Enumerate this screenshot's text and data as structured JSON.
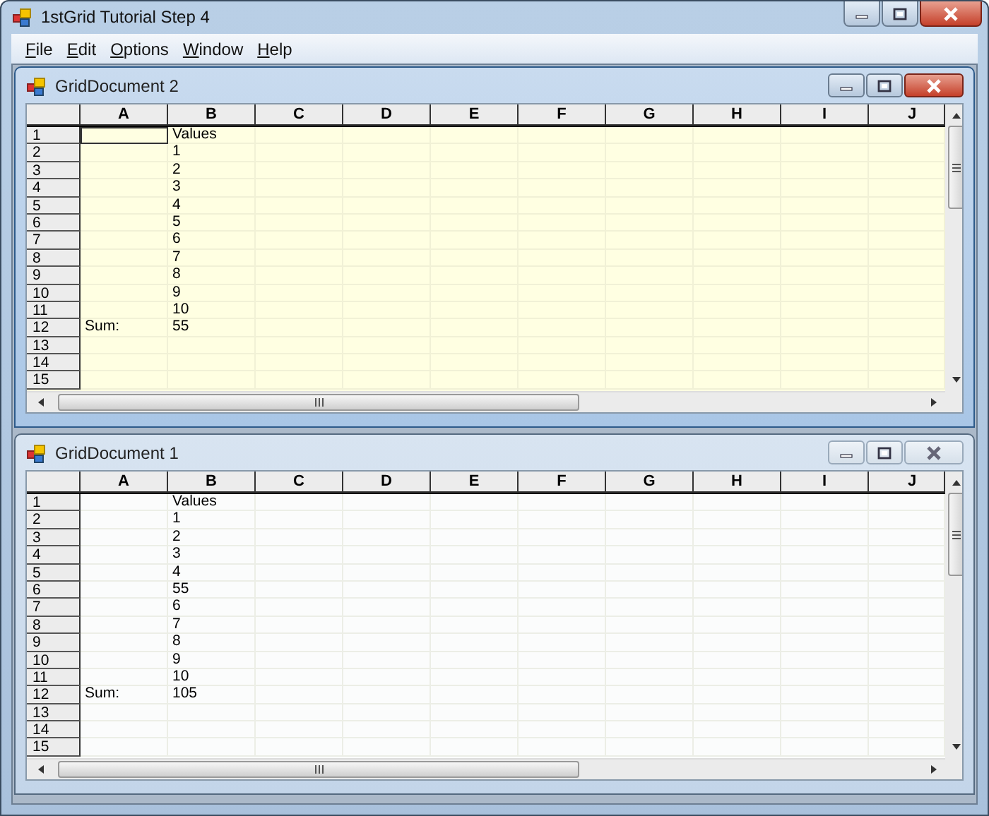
{
  "window": {
    "title": "1stGrid Tutorial Step 4"
  },
  "menu": [
    {
      "label": "File"
    },
    {
      "label": "Edit"
    },
    {
      "label": "Options"
    },
    {
      "label": "Window"
    },
    {
      "label": "Help"
    }
  ],
  "documents": [
    {
      "title": "GridDocument 2",
      "active": true,
      "columns": [
        "A",
        "B",
        "C",
        "D",
        "E",
        "F",
        "G",
        "H",
        "I",
        "J"
      ],
      "rows": [
        {
          "header": "1",
          "cells": [
            {
              "text": "",
              "selected": true
            },
            {
              "text": "Values",
              "selected": false
            }
          ]
        },
        {
          "header": "2",
          "cells": [
            {
              "text": "",
              "selected": false
            },
            {
              "text": "1",
              "selected": false
            }
          ]
        },
        {
          "header": "3",
          "cells": [
            {
              "text": "",
              "selected": false
            },
            {
              "text": "2",
              "selected": false
            }
          ]
        },
        {
          "header": "4",
          "cells": [
            {
              "text": "",
              "selected": false
            },
            {
              "text": "3",
              "selected": false
            }
          ]
        },
        {
          "header": "5",
          "cells": [
            {
              "text": "",
              "selected": false
            },
            {
              "text": "4",
              "selected": false
            }
          ]
        },
        {
          "header": "6",
          "cells": [
            {
              "text": "",
              "selected": false
            },
            {
              "text": "5",
              "selected": false
            }
          ]
        },
        {
          "header": "7",
          "cells": [
            {
              "text": "",
              "selected": false
            },
            {
              "text": "6",
              "selected": false
            }
          ]
        },
        {
          "header": "8",
          "cells": [
            {
              "text": "",
              "selected": false
            },
            {
              "text": "7",
              "selected": false
            }
          ]
        },
        {
          "header": "9",
          "cells": [
            {
              "text": "",
              "selected": false
            },
            {
              "text": "8",
              "selected": false
            }
          ]
        },
        {
          "header": "10",
          "cells": [
            {
              "text": "",
              "selected": false
            },
            {
              "text": "9",
              "selected": false
            }
          ]
        },
        {
          "header": "11",
          "cells": [
            {
              "text": "",
              "selected": false
            },
            {
              "text": "10",
              "selected": false
            }
          ]
        },
        {
          "header": "12",
          "cells": [
            {
              "text": "Sum:",
              "selected": false
            },
            {
              "text": "55",
              "selected": false
            }
          ]
        },
        {
          "header": "13",
          "cells": []
        },
        {
          "header": "14",
          "cells": []
        },
        {
          "header": "15",
          "cells": []
        }
      ]
    },
    {
      "title": "GridDocument 1",
      "active": false,
      "columns": [
        "A",
        "B",
        "C",
        "D",
        "E",
        "F",
        "G",
        "H",
        "I",
        "J"
      ],
      "rows": [
        {
          "header": "1",
          "cells": [
            {
              "text": "",
              "selected": false
            },
            {
              "text": "Values",
              "selected": false
            }
          ]
        },
        {
          "header": "2",
          "cells": [
            {
              "text": "",
              "selected": false
            },
            {
              "text": "1",
              "selected": false
            }
          ]
        },
        {
          "header": "3",
          "cells": [
            {
              "text": "",
              "selected": false
            },
            {
              "text": "2",
              "selected": false
            }
          ]
        },
        {
          "header": "4",
          "cells": [
            {
              "text": "",
              "selected": false
            },
            {
              "text": "3",
              "selected": false
            }
          ]
        },
        {
          "header": "5",
          "cells": [
            {
              "text": "",
              "selected": false
            },
            {
              "text": "4",
              "selected": false
            }
          ]
        },
        {
          "header": "6",
          "cells": [
            {
              "text": "",
              "selected": false
            },
            {
              "text": "55",
              "selected": false
            }
          ]
        },
        {
          "header": "7",
          "cells": [
            {
              "text": "",
              "selected": false
            },
            {
              "text": "6",
              "selected": false
            }
          ]
        },
        {
          "header": "8",
          "cells": [
            {
              "text": "",
              "selected": false
            },
            {
              "text": "7",
              "selected": false
            }
          ]
        },
        {
          "header": "9",
          "cells": [
            {
              "text": "",
              "selected": false
            },
            {
              "text": "8",
              "selected": false
            }
          ]
        },
        {
          "header": "10",
          "cells": [
            {
              "text": "",
              "selected": false
            },
            {
              "text": "9",
              "selected": false
            }
          ]
        },
        {
          "header": "11",
          "cells": [
            {
              "text": "",
              "selected": false
            },
            {
              "text": "10",
              "selected": false
            }
          ]
        },
        {
          "header": "12",
          "cells": [
            {
              "text": "Sum:",
              "selected": false
            },
            {
              "text": "105",
              "selected": false
            }
          ]
        },
        {
          "header": "13",
          "cells": []
        },
        {
          "header": "14",
          "cells": []
        },
        {
          "header": "15",
          "cells": []
        }
      ]
    }
  ]
}
